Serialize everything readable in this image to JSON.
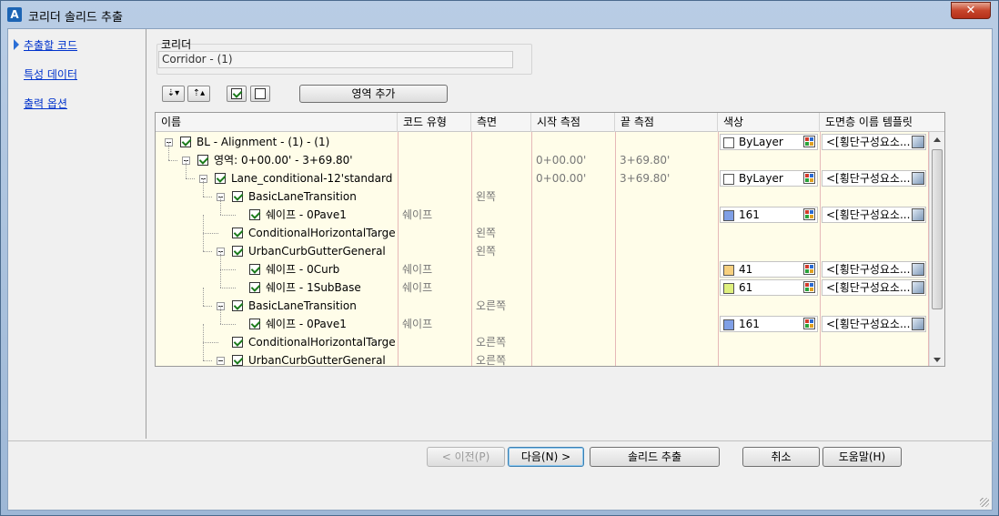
{
  "window": {
    "title": "코리더 솔리드 추출",
    "app_icon": "autocad-icon",
    "close_glyph": "✕"
  },
  "nav": {
    "items": [
      {
        "label": "추출할 코드"
      },
      {
        "label": "특성 데이터"
      },
      {
        "label": "출력 옵션"
      }
    ]
  },
  "corridor": {
    "label": "코리더",
    "value": "Corridor - (1)"
  },
  "toolbar": {
    "expand_glyph": "⇣▾",
    "collapse_glyph": "⇡▴",
    "add_region_label": "영역 추가"
  },
  "grid": {
    "headers": [
      "이름",
      "코드 유형",
      "측면",
      "시작 측점",
      "끝 측점",
      "색상",
      "도면층 이름 템플릿"
    ],
    "rows": [
      {
        "name": "BL - Alignment - (1) - (1)",
        "type": "",
        "side": "",
        "start": "",
        "end": "",
        "color": "ByLayer",
        "swatch": "#ffffff",
        "template": "<[횡단구성요소..."
      },
      {
        "name": "영역: 0+00.00' - 3+69.80'",
        "type": "",
        "side": "",
        "start": "0+00.00'",
        "end": "3+69.80'",
        "color": "",
        "swatch": "",
        "template": ""
      },
      {
        "name": "Lane_conditional-12'standard",
        "type": "",
        "side": "",
        "start": "0+00.00'",
        "end": "3+69.80'",
        "color": "ByLayer",
        "swatch": "#ffffff",
        "template": "<[횡단구성요소..."
      },
      {
        "name": "BasicLaneTransition",
        "type": "",
        "side": "왼쪽",
        "start": "",
        "end": "",
        "color": "",
        "swatch": "",
        "template": ""
      },
      {
        "name": "쉐이프 - 0Pave1",
        "type": "쉐이프",
        "side": "",
        "start": "",
        "end": "",
        "color": "161",
        "swatch": "#7f9fe6",
        "template": "<[횡단구성요소..."
      },
      {
        "name": "ConditionalHorizontalTarget",
        "type": "",
        "side": "왼쪽",
        "start": "",
        "end": "",
        "color": "",
        "swatch": "",
        "template": ""
      },
      {
        "name": "UrbanCurbGutterGeneral",
        "type": "",
        "side": "왼쪽",
        "start": "",
        "end": "",
        "color": "",
        "swatch": "",
        "template": ""
      },
      {
        "name": "쉐이프 - 0Curb",
        "type": "쉐이프",
        "side": "",
        "start": "",
        "end": "",
        "color": "41",
        "swatch": "#f7d07f",
        "template": "<[횡단구성요소..."
      },
      {
        "name": "쉐이프 - 1SubBase",
        "type": "쉐이프",
        "side": "",
        "start": "",
        "end": "",
        "color": "61",
        "swatch": "#dff07f",
        "template": "<[횡단구성요소..."
      },
      {
        "name": "BasicLaneTransition",
        "type": "",
        "side": "오른쪽",
        "start": "",
        "end": "",
        "color": "",
        "swatch": "",
        "template": ""
      },
      {
        "name": "쉐이프 - 0Pave1",
        "type": "쉐이프",
        "side": "",
        "start": "",
        "end": "",
        "color": "161",
        "swatch": "#7f9fe6",
        "template": "<[횡단구성요소..."
      },
      {
        "name": "ConditionalHorizontalTarget",
        "type": "",
        "side": "오른쪽",
        "start": "",
        "end": "",
        "color": "",
        "swatch": "",
        "template": ""
      },
      {
        "name": "UrbanCurbGutterGeneral",
        "type": "",
        "side": "오른쪽",
        "start": "",
        "end": "",
        "color": "",
        "swatch": "",
        "template": ""
      }
    ]
  },
  "buttons": {
    "back": "< 이전(P)",
    "next": "다음(N) >",
    "extract": "솔리드 추출",
    "cancel": "취소",
    "help": "도움말(H)"
  }
}
